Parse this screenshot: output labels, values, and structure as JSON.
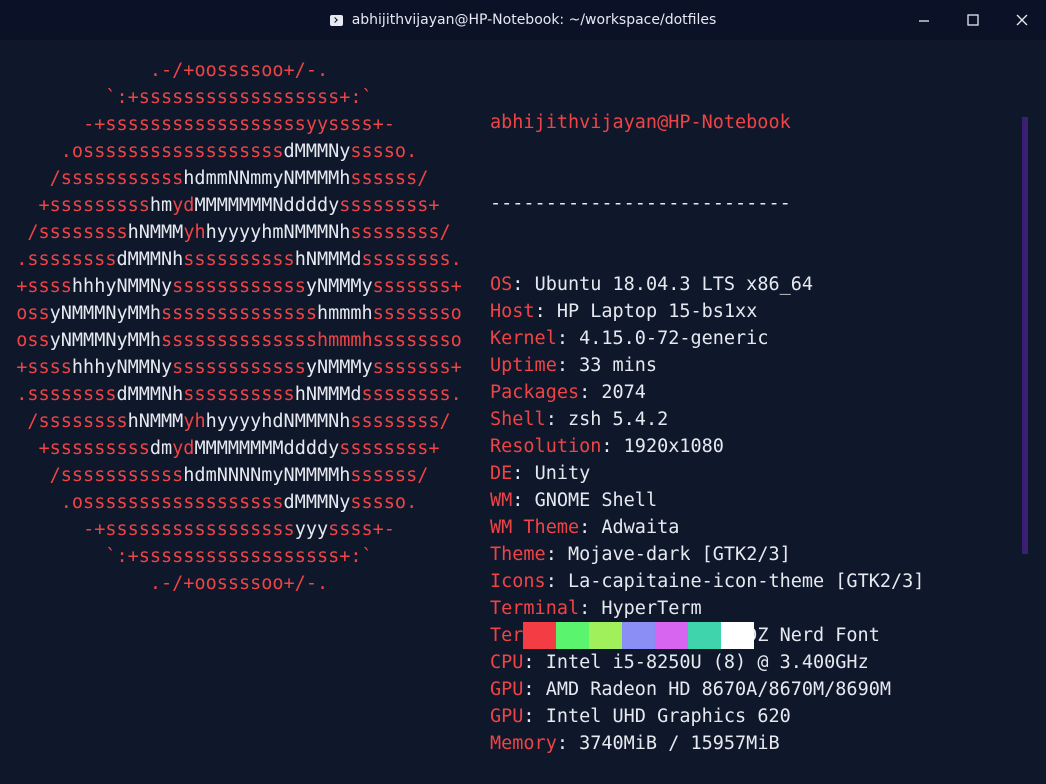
{
  "window": {
    "title": "abhijithvijayan@HP-Notebook: ~/workspace/dotfiles",
    "buttons": {
      "minimize": "minimize-icon",
      "maximize": "maximize-icon",
      "close": "close-icon"
    }
  },
  "ascii_art": [
    [
      [
        "r",
        ".-/+oossssoo+/-."
      ]
    ],
    [
      [
        "r",
        "`:+ssssssssssssssssss+:`"
      ]
    ],
    [
      [
        "r",
        "-+ssssssssssssssssssyyssss+-"
      ]
    ],
    [
      [
        "r",
        ".ossssssssssssssssss"
      ],
      [
        "w",
        "dMMMNy"
      ],
      [
        "r",
        "sssso."
      ]
    ],
    [
      [
        "r",
        "/sssssssssss"
      ],
      [
        "w",
        "hdmmNNmmyNMMMMh"
      ],
      [
        "r",
        "ssssss/"
      ]
    ],
    [
      [
        "r",
        "+sssssssss"
      ],
      [
        "w",
        "hm"
      ],
      [
        "r",
        "yd"
      ],
      [
        "w",
        "MMMMMMMNddddy"
      ],
      [
        "r",
        "ssssssss+"
      ]
    ],
    [
      [
        "r",
        "/ssssssss"
      ],
      [
        "w",
        "hNMMM"
      ],
      [
        "r",
        "yh"
      ],
      [
        "w",
        "hyyyyhmNMMMNh"
      ],
      [
        "r",
        "ssssssss/"
      ]
    ],
    [
      [
        "r",
        ".ssssssss"
      ],
      [
        "w",
        "dMMMNh"
      ],
      [
        "r",
        "ssssssssss"
      ],
      [
        "w",
        "hNMMMd"
      ],
      [
        "r",
        "ssssssss."
      ]
    ],
    [
      [
        "r",
        "+ssss"
      ],
      [
        "w",
        "hhhyNMMNy"
      ],
      [
        "r",
        "ssssssssssss"
      ],
      [
        "w",
        "yNMMMy"
      ],
      [
        "r",
        "sssssss+"
      ]
    ],
    [
      [
        "r",
        "oss"
      ],
      [
        "w",
        "yNMMMNyMMh"
      ],
      [
        "r",
        "ssssssssssssss"
      ],
      [
        "w",
        "hmmmh"
      ],
      [
        "r",
        "ssssssso"
      ]
    ],
    [
      [
        "r",
        "oss"
      ],
      [
        "w",
        "yNMMMNyMMh"
      ],
      [
        "r",
        "sssssssssssssshmmmhssssssso"
      ]
    ],
    [
      [
        "r",
        "+ssss"
      ],
      [
        "w",
        "hhhyNMMNy"
      ],
      [
        "r",
        "ssssssssssss"
      ],
      [
        "w",
        "yNMMMy"
      ],
      [
        "r",
        "sssssss+"
      ]
    ],
    [
      [
        "r",
        ".ssssssss"
      ],
      [
        "w",
        "dMMMNh"
      ],
      [
        "r",
        "ssssssssss"
      ],
      [
        "w",
        "hNMMMd"
      ],
      [
        "r",
        "ssssssss."
      ]
    ],
    [
      [
        "r",
        "/ssssssss"
      ],
      [
        "w",
        "hNMMM"
      ],
      [
        "r",
        "yh"
      ],
      [
        "w",
        "hyyyyhdNMMMNh"
      ],
      [
        "r",
        "ssssssss/"
      ]
    ],
    [
      [
        "r",
        "+sssssssss"
      ],
      [
        "w",
        "dm"
      ],
      [
        "r",
        "yd"
      ],
      [
        "w",
        "MMMMMMMMddddy"
      ],
      [
        "r",
        "ssssssss+"
      ]
    ],
    [
      [
        "r",
        "/sssssssssss"
      ],
      [
        "w",
        "hdmNNNNmyNMMMMh"
      ],
      [
        "r",
        "ssssss/"
      ]
    ],
    [
      [
        "r",
        ".ossssssssssssssssss"
      ],
      [
        "w",
        "dMMMNy"
      ],
      [
        "r",
        "sssso."
      ]
    ],
    [
      [
        "r",
        "-+sssssssssssssssss"
      ],
      [
        "w",
        "yyy"
      ],
      [
        "r",
        "ssss+-"
      ]
    ],
    [
      [
        "r",
        "`:+ssssssssssssssssss+:`"
      ]
    ],
    [
      [
        "r",
        ".-/+oossssoo+/-."
      ]
    ]
  ],
  "info": {
    "header": "abhijithvijayan@HP-Notebook",
    "separator": "---------------------------",
    "rows": [
      {
        "key": "OS",
        "value": "Ubuntu 18.04.3 LTS x86_64"
      },
      {
        "key": "Host",
        "value": "HP Laptop 15-bs1xx"
      },
      {
        "key": "Kernel",
        "value": "4.15.0-72-generic"
      },
      {
        "key": "Uptime",
        "value": "33 mins"
      },
      {
        "key": "Packages",
        "value": "2074"
      },
      {
        "key": "Shell",
        "value": "zsh 5.4.2"
      },
      {
        "key": "Resolution",
        "value": "1920x1080"
      },
      {
        "key": "DE",
        "value": "Unity"
      },
      {
        "key": "WM",
        "value": "GNOME Shell"
      },
      {
        "key": "WM Theme",
        "value": "Adwaita"
      },
      {
        "key": "Theme",
        "value": "Mojave-dark [GTK2/3]"
      },
      {
        "key": "Icons",
        "value": "La-capitaine-icon-theme [GTK2/3]"
      },
      {
        "key": "Terminal",
        "value": "HyperTerm"
      },
      {
        "key": "Terminal Font",
        "value": "MesloLGMDZ Nerd Font"
      },
      {
        "key": "CPU",
        "value": "Intel i5-8250U (8) @ 3.400GHz"
      },
      {
        "key": "GPU",
        "value": "AMD Radeon HD 8670A/8670M/8690M"
      },
      {
        "key": "GPU",
        "value": "Intel UHD Graphics 620"
      },
      {
        "key": "Memory",
        "value": "3740MiB / 15957MiB"
      }
    ]
  },
  "palette": [
    "#f43c44",
    "#5bf46e",
    "#9ff05a",
    "#8b8ef5",
    "#d865f0",
    "#3fd4ac",
    "#ffffff"
  ],
  "colors": {
    "accent": "#ef4446",
    "text": "#e6e9f0",
    "background": "#0f172a",
    "titlebar": "#0b1228",
    "scrollbar": "#3a1f74"
  }
}
